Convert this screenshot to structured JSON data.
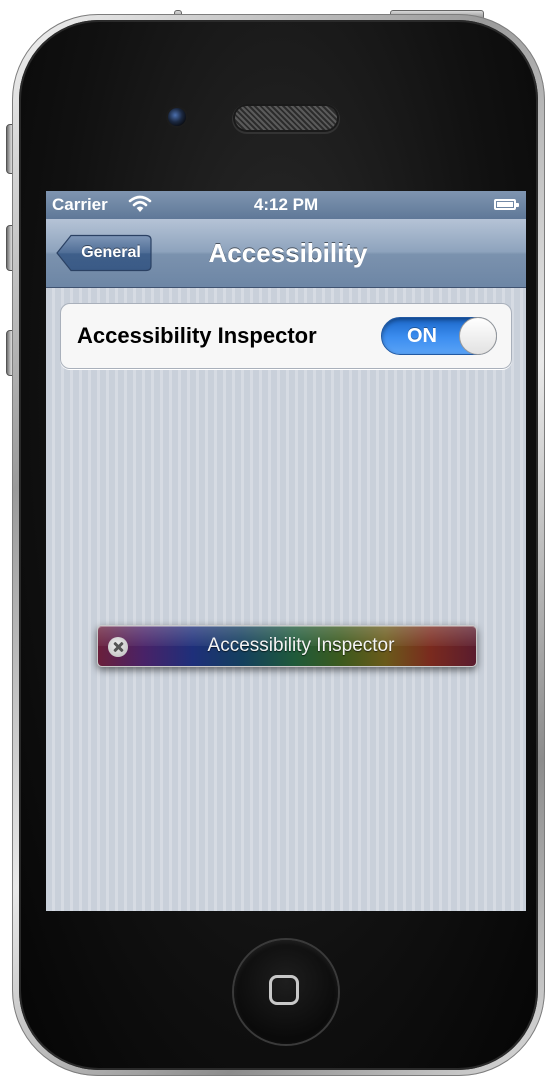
{
  "status_bar": {
    "carrier": "Carrier",
    "time": "4:12 PM",
    "wifi_icon": "wifi-icon",
    "battery_icon": "battery-icon"
  },
  "nav_bar": {
    "back_label": "General",
    "title": "Accessibility"
  },
  "settings": {
    "accessibility_inspector": {
      "label": "Accessibility Inspector",
      "toggle_state": "ON",
      "accent": "#2e7ce0"
    }
  },
  "inspector_panel": {
    "title": "Accessibility Inspector",
    "close_icon": "close-icon"
  },
  "device": {
    "home_button_icon": "home-square-icon"
  }
}
